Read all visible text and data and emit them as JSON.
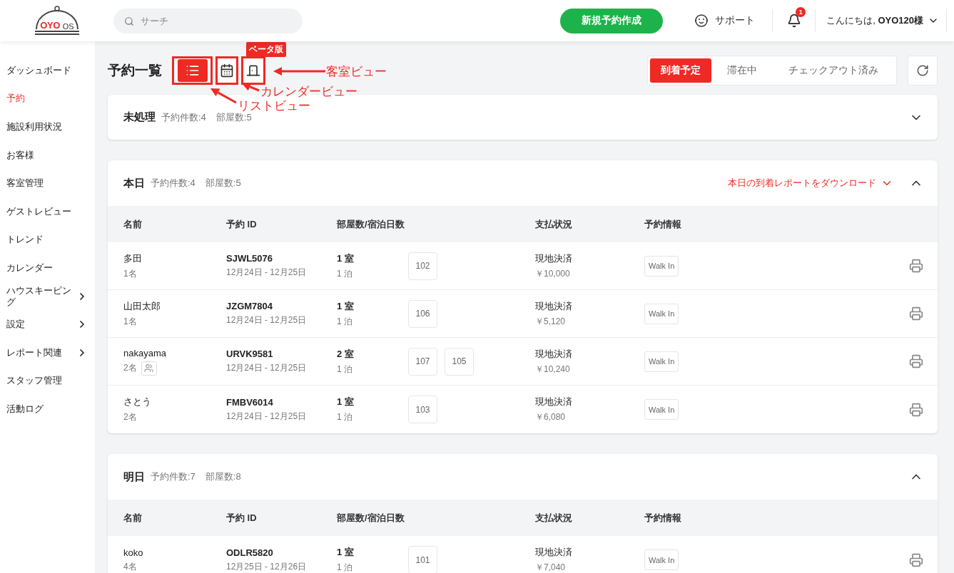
{
  "header": {
    "logo": {
      "brand": "OYO",
      "suffix": "OS"
    },
    "search": {
      "placeholder": "サーチ"
    },
    "new_booking_button": "新規予約作成",
    "support_link": "サポート",
    "notifications": {
      "count": "1"
    },
    "greeting": "こんにちは, **OYO120様**"
  },
  "sidebar": {
    "items": [
      {
        "label": "ダッシュボード",
        "selected": false,
        "submenu": false
      },
      {
        "label": "予約",
        "selected": true,
        "submenu": false
      },
      {
        "label": "施設利用状況",
        "selected": false,
        "submenu": false
      },
      {
        "label": "お客様",
        "selected": false,
        "submenu": false
      },
      {
        "label": "客室管理",
        "selected": false,
        "submenu": false
      },
      {
        "label": "ゲストレビュー",
        "selected": false,
        "submenu": false
      },
      {
        "label": "トレンド",
        "selected": false,
        "submenu": false
      },
      {
        "label": "カレンダー",
        "selected": false,
        "submenu": false
      },
      {
        "label": "ハウスキーピング",
        "selected": false,
        "submenu": true
      },
      {
        "label": "設定",
        "selected": false,
        "submenu": true
      },
      {
        "label": "レポート関連",
        "selected": false,
        "submenu": true
      },
      {
        "label": "スタッフ管理",
        "selected": false,
        "submenu": false
      },
      {
        "label": "活動ログ",
        "selected": false,
        "submenu": false
      }
    ]
  },
  "page_title": "予約一覧",
  "view_toggle": [
    {
      "kind": "list",
      "selected": true,
      "annotated": true
    },
    {
      "kind": "calendar",
      "selected": false,
      "annotated": true
    },
    {
      "kind": "room",
      "selected": false,
      "annotated": true,
      "badge": "ベータ版"
    }
  ],
  "annotations": [
    {
      "label": "客室ビュー"
    },
    {
      "label": "カレンダービュー"
    },
    {
      "label": "リストビュー"
    }
  ],
  "status_tabs": [
    {
      "label": "到着予定",
      "selected": true
    },
    {
      "label": "滞在中",
      "selected": false
    },
    {
      "label": "チェックアウト済み",
      "selected": false
    }
  ],
  "sections": [
    {
      "title": "未処理",
      "bookings": "予約件数:4",
      "rooms": "部屋数:5",
      "expanded": false
    },
    {
      "title": "本日",
      "bookings": "予約件数:4",
      "rooms": "部屋数:5",
      "expanded": true,
      "download_link": "本日の到着レポートをダウンロード",
      "columns": [
        "名前",
        "予約 ID",
        "部屋数/宿泊日数",
        "支払状況",
        "予約情報"
      ],
      "rows": [
        {
          "name": "多田",
          "guests": "1名",
          "group": false,
          "booking_id": "SJWL5076",
          "dates": "12月24日 - 12月25日",
          "room_count": "1 室",
          "nights": "1 泊",
          "room_numbers": [
            "102"
          ],
          "payment": "現地決済",
          "amount": "￥10,000",
          "source": "Walk In"
        },
        {
          "name": "山田太郎",
          "guests": "1名",
          "group": false,
          "booking_id": "JZGM7804",
          "dates": "12月24日 - 12月25日",
          "room_count": "1 室",
          "nights": "1 泊",
          "room_numbers": [
            "106"
          ],
          "payment": "現地決済",
          "amount": "￥5,120",
          "source": "Walk In"
        },
        {
          "name": "nakayama",
          "guests": "2名",
          "group": true,
          "booking_id": "URVK9581",
          "dates": "12月24日 - 12月25日",
          "room_count": "2 室",
          "nights": "1 泊",
          "room_numbers": [
            "107",
            "105"
          ],
          "payment": "現地決済",
          "amount": "￥10,240",
          "source": "Walk In"
        },
        {
          "name": "さとう",
          "guests": "2名",
          "group": false,
          "booking_id": "FMBV6014",
          "dates": "12月24日 - 12月25日",
          "room_count": "1 室",
          "nights": "1 泊",
          "room_numbers": [
            "103"
          ],
          "payment": "現地決済",
          "amount": "￥6,080",
          "source": "Walk In"
        }
      ]
    },
    {
      "title": "明日",
      "bookings": "予約件数:7",
      "rooms": "部屋数:8",
      "expanded": true,
      "columns": [
        "名前",
        "予約 ID",
        "部屋数/宿泊日数",
        "支払状況",
        "予約情報"
      ],
      "rows": [
        {
          "name": "koko",
          "guests": "4名",
          "group": false,
          "booking_id": "ODLR5820",
          "dates": "12月25日 - 12月26日",
          "room_count": "1 室",
          "nights": "1 泊",
          "room_numbers": [
            "101"
          ],
          "payment": "現地決済",
          "amount": "￥7,040",
          "source": "Walk In"
        }
      ]
    }
  ]
}
